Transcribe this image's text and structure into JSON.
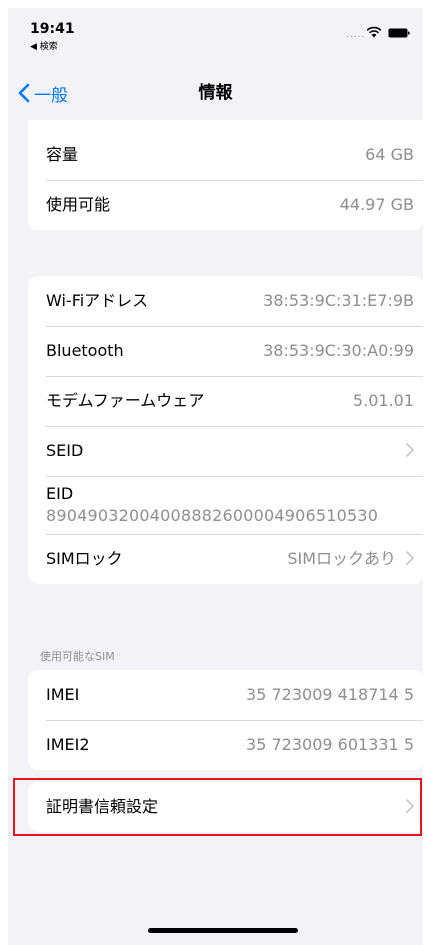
{
  "status_bar": {
    "time": "19:41",
    "back_app": "◀ 検索",
    "signal": "....."
  },
  "nav": {
    "back_label": "一般",
    "title": "情報"
  },
  "top_group": [
    {
      "label": "容量",
      "value": "64 GB"
    },
    {
      "label": "使用可能",
      "value": "44.97 GB"
    }
  ],
  "network_group": {
    "wifi": {
      "label": "Wi-Fiアドレス",
      "value": "38:53:9C:31:E7:9B"
    },
    "bluetooth": {
      "label": "Bluetooth",
      "value": "38:53:9C:30:A0:99"
    },
    "modem": {
      "label": "モデムファームウェア",
      "value": "5.01.01"
    },
    "seid": {
      "label": "SEID"
    },
    "eid": {
      "label": "EID",
      "value": "89049032004008882600004906510530"
    },
    "simlock": {
      "label": "SIMロック",
      "value": "SIMロックあり"
    }
  },
  "sim_section_header": "使用可能なSIM",
  "sim_group": [
    {
      "label": "IMEI",
      "value": "35 723009 418714 5"
    },
    {
      "label": "IMEI2",
      "value": "35 723009 601331 5"
    }
  ],
  "cert_group": {
    "label": "証明書信頼設定"
  },
  "colors": {
    "accent": "#007aff",
    "highlight": "#e3161d",
    "background": "#f2f2f7"
  }
}
